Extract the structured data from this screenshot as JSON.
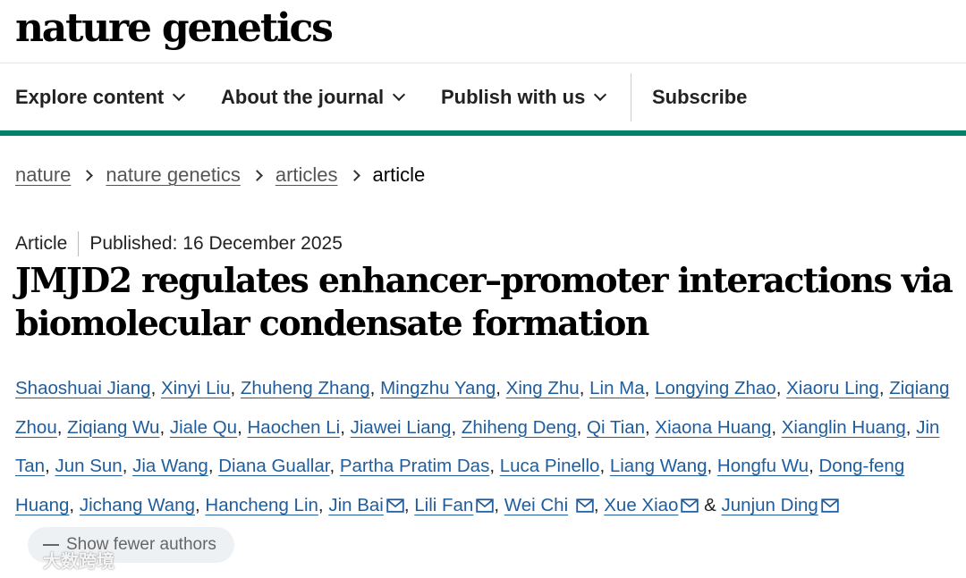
{
  "site": {
    "logo": "nature genetics"
  },
  "nav": {
    "explore": "Explore content",
    "about": "About the journal",
    "publish": "Publish with us",
    "subscribe": "Subscribe"
  },
  "breadcrumb": [
    "nature",
    "nature genetics",
    "articles",
    "article"
  ],
  "article": {
    "type": "Article",
    "published": "Published: 16 December 2025",
    "title": "JMJD2 regulates enhancer–promoter interactions via biomolecular condensate formation",
    "authors": [
      "Shaoshuai Jiang",
      "Xinyi Liu",
      "Zhuheng Zhang",
      "Mingzhu Yang",
      "Xing Zhu",
      "Lin Ma",
      "Longying Zhao",
      "Xiaoru Ling",
      "Ziqiang Zhou",
      "Ziqiang Wu",
      "Jiale Qu",
      "Haochen Li",
      "Jiawei Liang",
      "Zhiheng Deng",
      "Qi Tian",
      "Xiaona Huang",
      "Xianglin Huang",
      "Jin Tan",
      "Jun Sun",
      "Jia Wang",
      "Diana Guallar",
      "Partha Pratim Das",
      "Luca Pinello",
      "Liang Wang",
      "Hongfu Wu",
      "Dong-feng Huang",
      "Jichang Wang",
      "Hancheng Lin",
      "Jin Bai",
      "Lili Fan",
      "Wei Chi",
      "Xue Xiao",
      "Junjun Ding"
    ],
    "show_fewer": "Show fewer authors"
  },
  "watermark": "大数跨境",
  "icons": {
    "mail": "mail-icon",
    "chevron": "chevron-down-icon",
    "breadcrumb_sep": "chevron-right-icon"
  },
  "colors": {
    "accent_bar": "#00826a",
    "author_link": "#1f5d9c"
  }
}
